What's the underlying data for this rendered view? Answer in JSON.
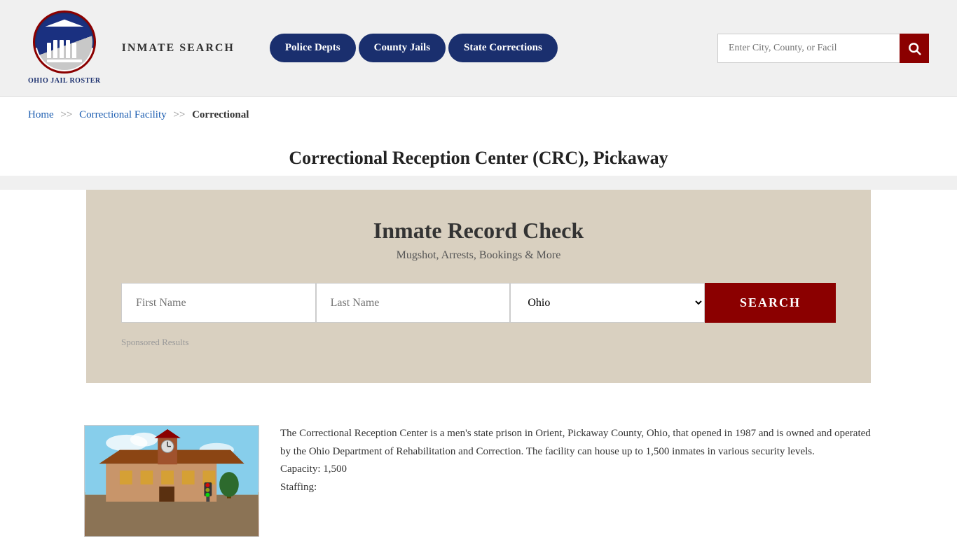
{
  "header": {
    "logo_line1": "Ohio Jail Roster",
    "inmate_search_label": "INMATE SEARCH",
    "nav": {
      "police_depts": "Police Depts",
      "county_jails": "County Jails",
      "state_corrections": "State Corrections"
    },
    "search_placeholder": "Enter City, County, or Facil"
  },
  "breadcrumb": {
    "home": "Home",
    "separator": ">>",
    "correctional_facility": "Correctional Facility",
    "current": "Correctional"
  },
  "page_title": "Correctional Reception Center (CRC), Pickaway",
  "record_check": {
    "title": "Inmate Record Check",
    "subtitle": "Mugshot, Arrests, Bookings & More",
    "first_name_placeholder": "First Name",
    "last_name_placeholder": "Last Name",
    "state_value": "Ohio",
    "search_button": "SEARCH",
    "sponsored_label": "Sponsored Results"
  },
  "facility": {
    "description": "The Correctional Reception Center is a men's state prison in Orient, Pickaway County, Ohio, that opened in 1987 and is owned and operated by the Ohio Department of Rehabilitation and Correction. The facility can house up to 1,500 inmates in various security levels.",
    "capacity": "Capacity: 1,500",
    "staffing_label": "Staffing:"
  }
}
